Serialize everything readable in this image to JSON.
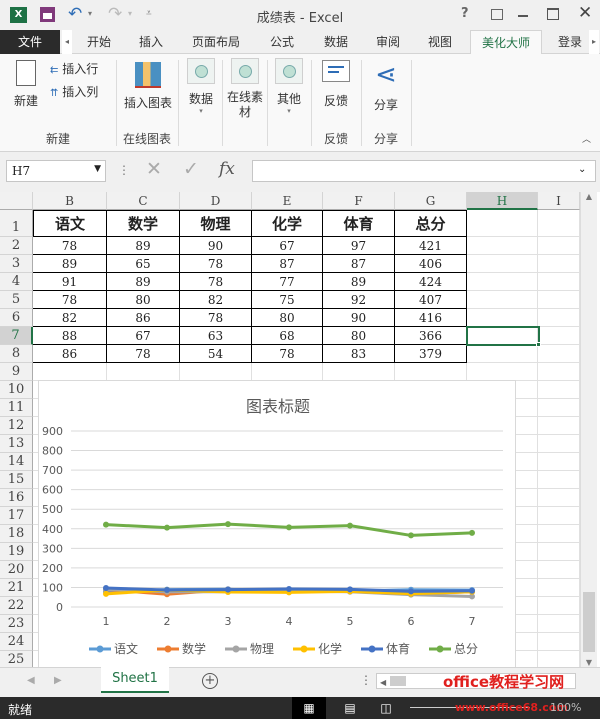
{
  "window": {
    "title": "成绩表 - Excel",
    "help": "?"
  },
  "tabs": [
    "文件",
    "开始",
    "插入",
    "页面布局",
    "公式",
    "数据",
    "审阅",
    "视图",
    "美化大师",
    "登录"
  ],
  "ribbon": {
    "buttons": {
      "new": "新建",
      "insert_row": "插入行",
      "insert_col": "插入列",
      "insert_chart": "插入图表",
      "data": "数据",
      "online_material": "在线素材",
      "other": "其他",
      "feedback": "反馈",
      "share": "分享"
    },
    "groups": {
      "new": "新建",
      "online_chart": "在线图表",
      "feedback": "反馈",
      "share": "分享"
    }
  },
  "formula_bar": {
    "name_box": "H7",
    "fx": "fx",
    "value": ""
  },
  "columns": [
    "B",
    "C",
    "D",
    "E",
    "F",
    "G",
    "H",
    "I"
  ],
  "rows": [
    "1",
    "2",
    "3",
    "4",
    "5",
    "6",
    "7",
    "8",
    "9",
    "10",
    "11",
    "12",
    "13",
    "14",
    "15",
    "16",
    "17",
    "18",
    "19",
    "20",
    "21",
    "22",
    "23",
    "24",
    "25"
  ],
  "table": {
    "headers": [
      "语文",
      "数学",
      "物理",
      "化学",
      "体育",
      "总分"
    ],
    "rows": [
      [
        "78",
        "89",
        "90",
        "67",
        "97",
        "421"
      ],
      [
        "89",
        "65",
        "78",
        "87",
        "87",
        "406"
      ],
      [
        "91",
        "89",
        "78",
        "77",
        "89",
        "424"
      ],
      [
        "78",
        "80",
        "82",
        "75",
        "92",
        "407"
      ],
      [
        "82",
        "86",
        "78",
        "80",
        "90",
        "416"
      ],
      [
        "88",
        "67",
        "63",
        "68",
        "80",
        "366"
      ],
      [
        "86",
        "78",
        "54",
        "78",
        "83",
        "379"
      ]
    ]
  },
  "selected_cell": "H7",
  "chart_data": {
    "type": "line",
    "title": "图表标题",
    "x": [
      1,
      2,
      3,
      4,
      5,
      6,
      7
    ],
    "ylim": [
      0,
      900
    ],
    "yticks": [
      0,
      100,
      200,
      300,
      400,
      500,
      600,
      700,
      800,
      900
    ],
    "legend": "bottom",
    "grid": true,
    "series": [
      {
        "name": "语文",
        "color": "#5b9bd5",
        "values": [
          78,
          89,
          91,
          78,
          82,
          88,
          86
        ]
      },
      {
        "name": "数学",
        "color": "#ed7d31",
        "values": [
          89,
          65,
          89,
          80,
          86,
          67,
          78
        ]
      },
      {
        "name": "物理",
        "color": "#a5a5a5",
        "values": [
          90,
          78,
          78,
          82,
          78,
          63,
          54
        ]
      },
      {
        "name": "化学",
        "color": "#ffc000",
        "values": [
          67,
          87,
          77,
          75,
          80,
          68,
          78
        ]
      },
      {
        "name": "体育",
        "color": "#4472c4",
        "values": [
          97,
          87,
          89,
          92,
          90,
          80,
          83
        ]
      },
      {
        "name": "总分",
        "color": "#70ad47",
        "values": [
          421,
          406,
          424,
          407,
          416,
          366,
          379
        ]
      }
    ]
  },
  "sheet_tabs": [
    "Sheet1"
  ],
  "status": {
    "ready": "就绪",
    "zoom": "100%"
  },
  "watermark": {
    "line1": "office教程学习网",
    "line2": "www.office68.com"
  }
}
